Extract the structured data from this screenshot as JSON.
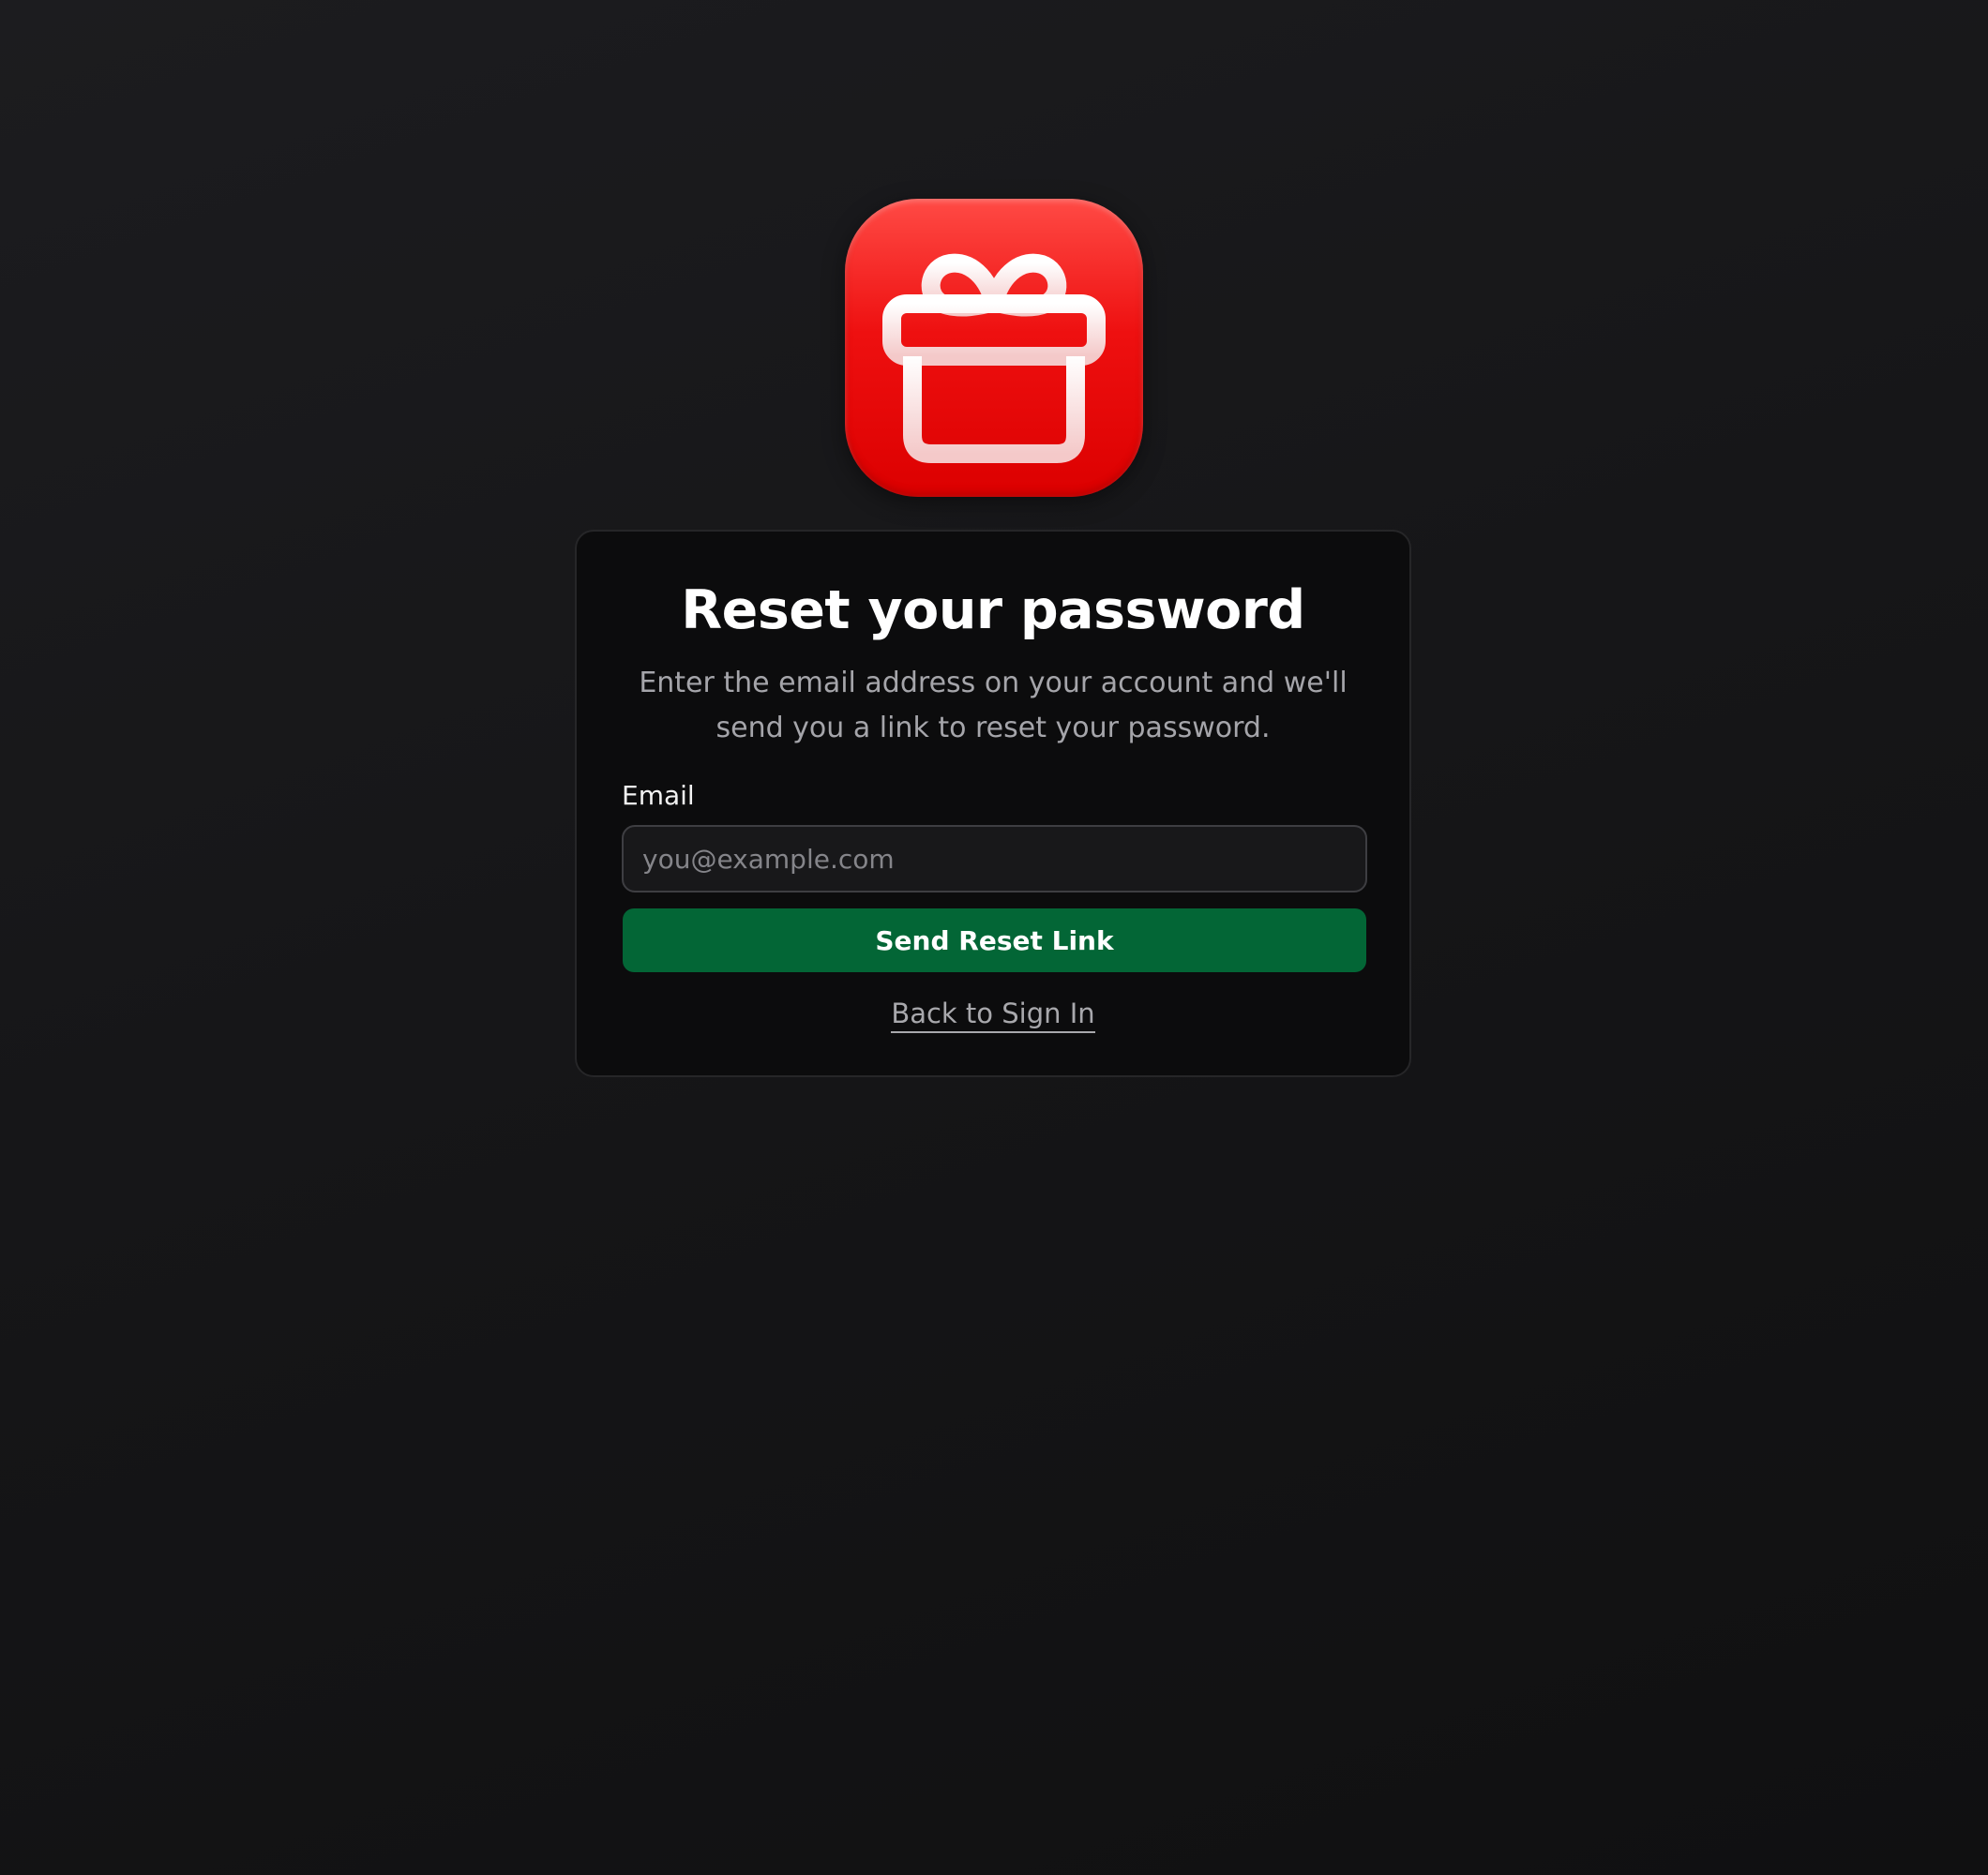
{
  "app": {
    "icon": "gift-icon",
    "icon_color": "#e60a0a"
  },
  "card": {
    "title": "Reset your password",
    "subtitle": "Enter the email address on your account and we'll send you a link to reset your password."
  },
  "form": {
    "email_label": "Email",
    "email_value": "",
    "email_placeholder": "you@example.com",
    "submit_label": "Send Reset Link",
    "submit_color": "#036636"
  },
  "footer": {
    "back_link_label": "Back to Sign In"
  }
}
